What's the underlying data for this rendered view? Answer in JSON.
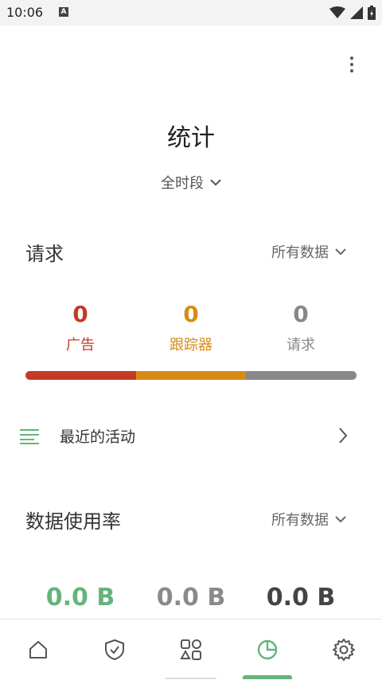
{
  "status_bar": {
    "time": "10:06",
    "notification_letter": "A"
  },
  "header": {
    "title": "统计",
    "period": "全时段"
  },
  "requests": {
    "title": "请求",
    "filter": "所有数据",
    "stats": [
      {
        "value": "0",
        "label": "广告",
        "color": "#c23b22"
      },
      {
        "value": "0",
        "label": "跟踪器",
        "color": "#d98a14"
      },
      {
        "value": "0",
        "label": "请求",
        "color": "#888888"
      }
    ],
    "bar_segments": [
      {
        "color": "#c23b22",
        "fraction": 0.333
      },
      {
        "color": "#d98a14",
        "fraction": 0.333
      },
      {
        "color": "#888888",
        "fraction": 0.334
      }
    ]
  },
  "activity": {
    "label": "最近的活动"
  },
  "usage": {
    "title": "数据使用率",
    "filter": "所有数据",
    "values": [
      {
        "value": "0.0 B",
        "color": "#67b27c"
      },
      {
        "value": "0.0 B",
        "color": "#8a8a8a"
      },
      {
        "value": "0.0 B",
        "color": "#444444"
      }
    ]
  },
  "nav": {
    "items": [
      "home-icon",
      "shield-check-icon",
      "apps-icon",
      "pie-chart-icon",
      "gear-icon"
    ],
    "active_index": 3,
    "accent": "#67b27c"
  }
}
